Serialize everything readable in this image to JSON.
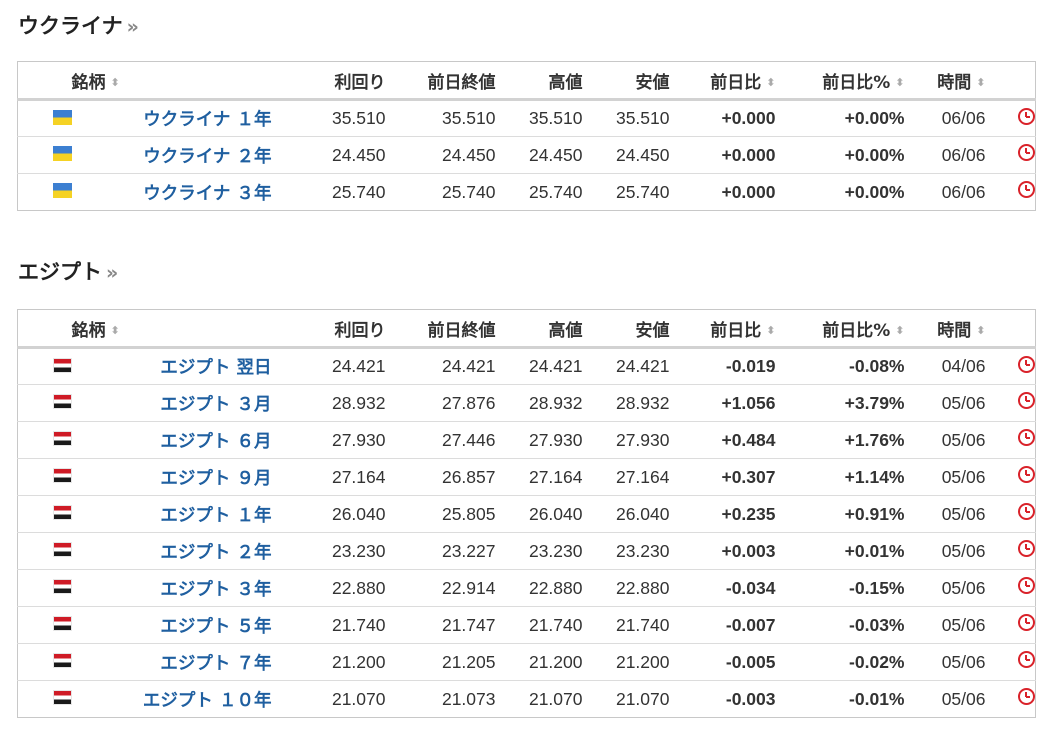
{
  "columns": {
    "name": "銘柄",
    "yield": "利回り",
    "prev_close": "前日終値",
    "high": "高値",
    "low": "安値",
    "change": "前日比",
    "change_pct": "前日比%",
    "time": "時間"
  },
  "sort_glyph": "⬍",
  "raquo": "»",
  "colors": {
    "up": "#e60000",
    "down": "#0c9b0c",
    "link": "#1f5fa0",
    "clock": "#d9222a"
  },
  "sections": [
    {
      "title": "ウクライナ",
      "flag": "ukraine-flag",
      "rows": [
        {
          "name": "ウクライナ １年",
          "yield": "35.510",
          "prev_close": "35.510",
          "high": "35.510",
          "low": "35.510",
          "change": "+0.000",
          "change_pct": "+0.00%",
          "time": "06/06",
          "dir": "up"
        },
        {
          "name": "ウクライナ ２年",
          "yield": "24.450",
          "prev_close": "24.450",
          "high": "24.450",
          "low": "24.450",
          "change": "+0.000",
          "change_pct": "+0.00%",
          "time": "06/06",
          "dir": "up"
        },
        {
          "name": "ウクライナ ３年",
          "yield": "25.740",
          "prev_close": "25.740",
          "high": "25.740",
          "low": "25.740",
          "change": "+0.000",
          "change_pct": "+0.00%",
          "time": "06/06",
          "dir": "up"
        }
      ]
    },
    {
      "title": "エジプト",
      "flag": "egypt-flag",
      "rows": [
        {
          "name": "エジプト 翌日",
          "yield": "24.421",
          "prev_close": "24.421",
          "high": "24.421",
          "low": "24.421",
          "change": "-0.019",
          "change_pct": "-0.08%",
          "time": "04/06",
          "dir": "down"
        },
        {
          "name": "エジプト ３月",
          "yield": "28.932",
          "prev_close": "27.876",
          "high": "28.932",
          "low": "28.932",
          "change": "+1.056",
          "change_pct": "+3.79%",
          "time": "05/06",
          "dir": "up"
        },
        {
          "name": "エジプト ６月",
          "yield": "27.930",
          "prev_close": "27.446",
          "high": "27.930",
          "low": "27.930",
          "change": "+0.484",
          "change_pct": "+1.76%",
          "time": "05/06",
          "dir": "up"
        },
        {
          "name": "エジプト ９月",
          "yield": "27.164",
          "prev_close": "26.857",
          "high": "27.164",
          "low": "27.164",
          "change": "+0.307",
          "change_pct": "+1.14%",
          "time": "05/06",
          "dir": "up"
        },
        {
          "name": "エジプト １年",
          "yield": "26.040",
          "prev_close": "25.805",
          "high": "26.040",
          "low": "26.040",
          "change": "+0.235",
          "change_pct": "+0.91%",
          "time": "05/06",
          "dir": "up"
        },
        {
          "name": "エジプト ２年",
          "yield": "23.230",
          "prev_close": "23.227",
          "high": "23.230",
          "low": "23.230",
          "change": "+0.003",
          "change_pct": "+0.01%",
          "time": "05/06",
          "dir": "up"
        },
        {
          "name": "エジプト ３年",
          "yield": "22.880",
          "prev_close": "22.914",
          "high": "22.880",
          "low": "22.880",
          "change": "-0.034",
          "change_pct": "-0.15%",
          "time": "05/06",
          "dir": "down"
        },
        {
          "name": "エジプト ５年",
          "yield": "21.740",
          "prev_close": "21.747",
          "high": "21.740",
          "low": "21.740",
          "change": "-0.007",
          "change_pct": "-0.03%",
          "time": "05/06",
          "dir": "down"
        },
        {
          "name": "エジプト ７年",
          "yield": "21.200",
          "prev_close": "21.205",
          "high": "21.200",
          "low": "21.200",
          "change": "-0.005",
          "change_pct": "-0.02%",
          "time": "05/06",
          "dir": "down"
        },
        {
          "name": "エジプト １０年",
          "yield": "21.070",
          "prev_close": "21.073",
          "high": "21.070",
          "low": "21.070",
          "change": "-0.003",
          "change_pct": "-0.01%",
          "time": "05/06",
          "dir": "down"
        }
      ]
    }
  ]
}
